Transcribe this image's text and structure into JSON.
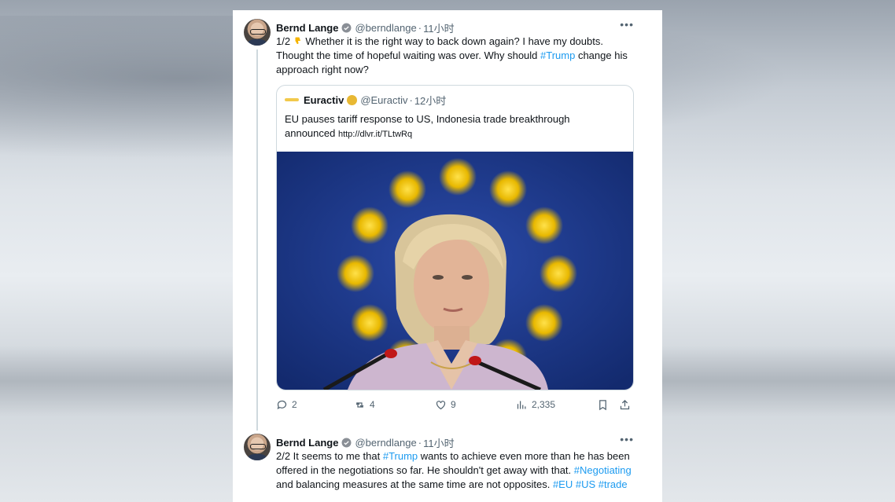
{
  "tweets": [
    {
      "author": "Bernd Lange",
      "handle": "@berndlange",
      "time": "11小时",
      "text_parts": [
        "1/2 ",
        "Whether it is the right way to back down again? I have my doubts. Thought the time of hopeful waiting was over. Why should ",
        "#Trump",
        " change his approach right now?"
      ],
      "quote": {
        "author": "Euractiv",
        "handle": "@Euractiv",
        "time": "12小时",
        "text": "EU pauses tariff response to US, Indonesia trade breakthrough announced ",
        "link": "http://dlvr.it/TLtwRq"
      },
      "metrics": {
        "replies": "2",
        "retweets": "4",
        "likes": "9",
        "views": "2,335"
      }
    },
    {
      "author": "Bernd Lange",
      "handle": "@berndlange",
      "time": "11小时",
      "text_parts": [
        "2/2 It seems to me that ",
        "#Trump",
        " wants to achieve even more than he has been offered in the negotiations so far. He shouldn't get away with that. ",
        "#Negotiating",
        " and balancing measures at the same time are not opposites. ",
        "#EU #US #trade"
      ]
    }
  ],
  "colors": {
    "link": "#1d9bf0",
    "text": "#0f1419",
    "muted": "#536471",
    "eu_blue": "#1d3a8a",
    "eu_star": "#f2c400"
  },
  "icons": [
    "verified-icon",
    "more-icon",
    "thumbs-down-emoji",
    "reply-icon",
    "retweet-icon",
    "like-icon",
    "views-icon",
    "bookmark-icon",
    "share-icon"
  ]
}
